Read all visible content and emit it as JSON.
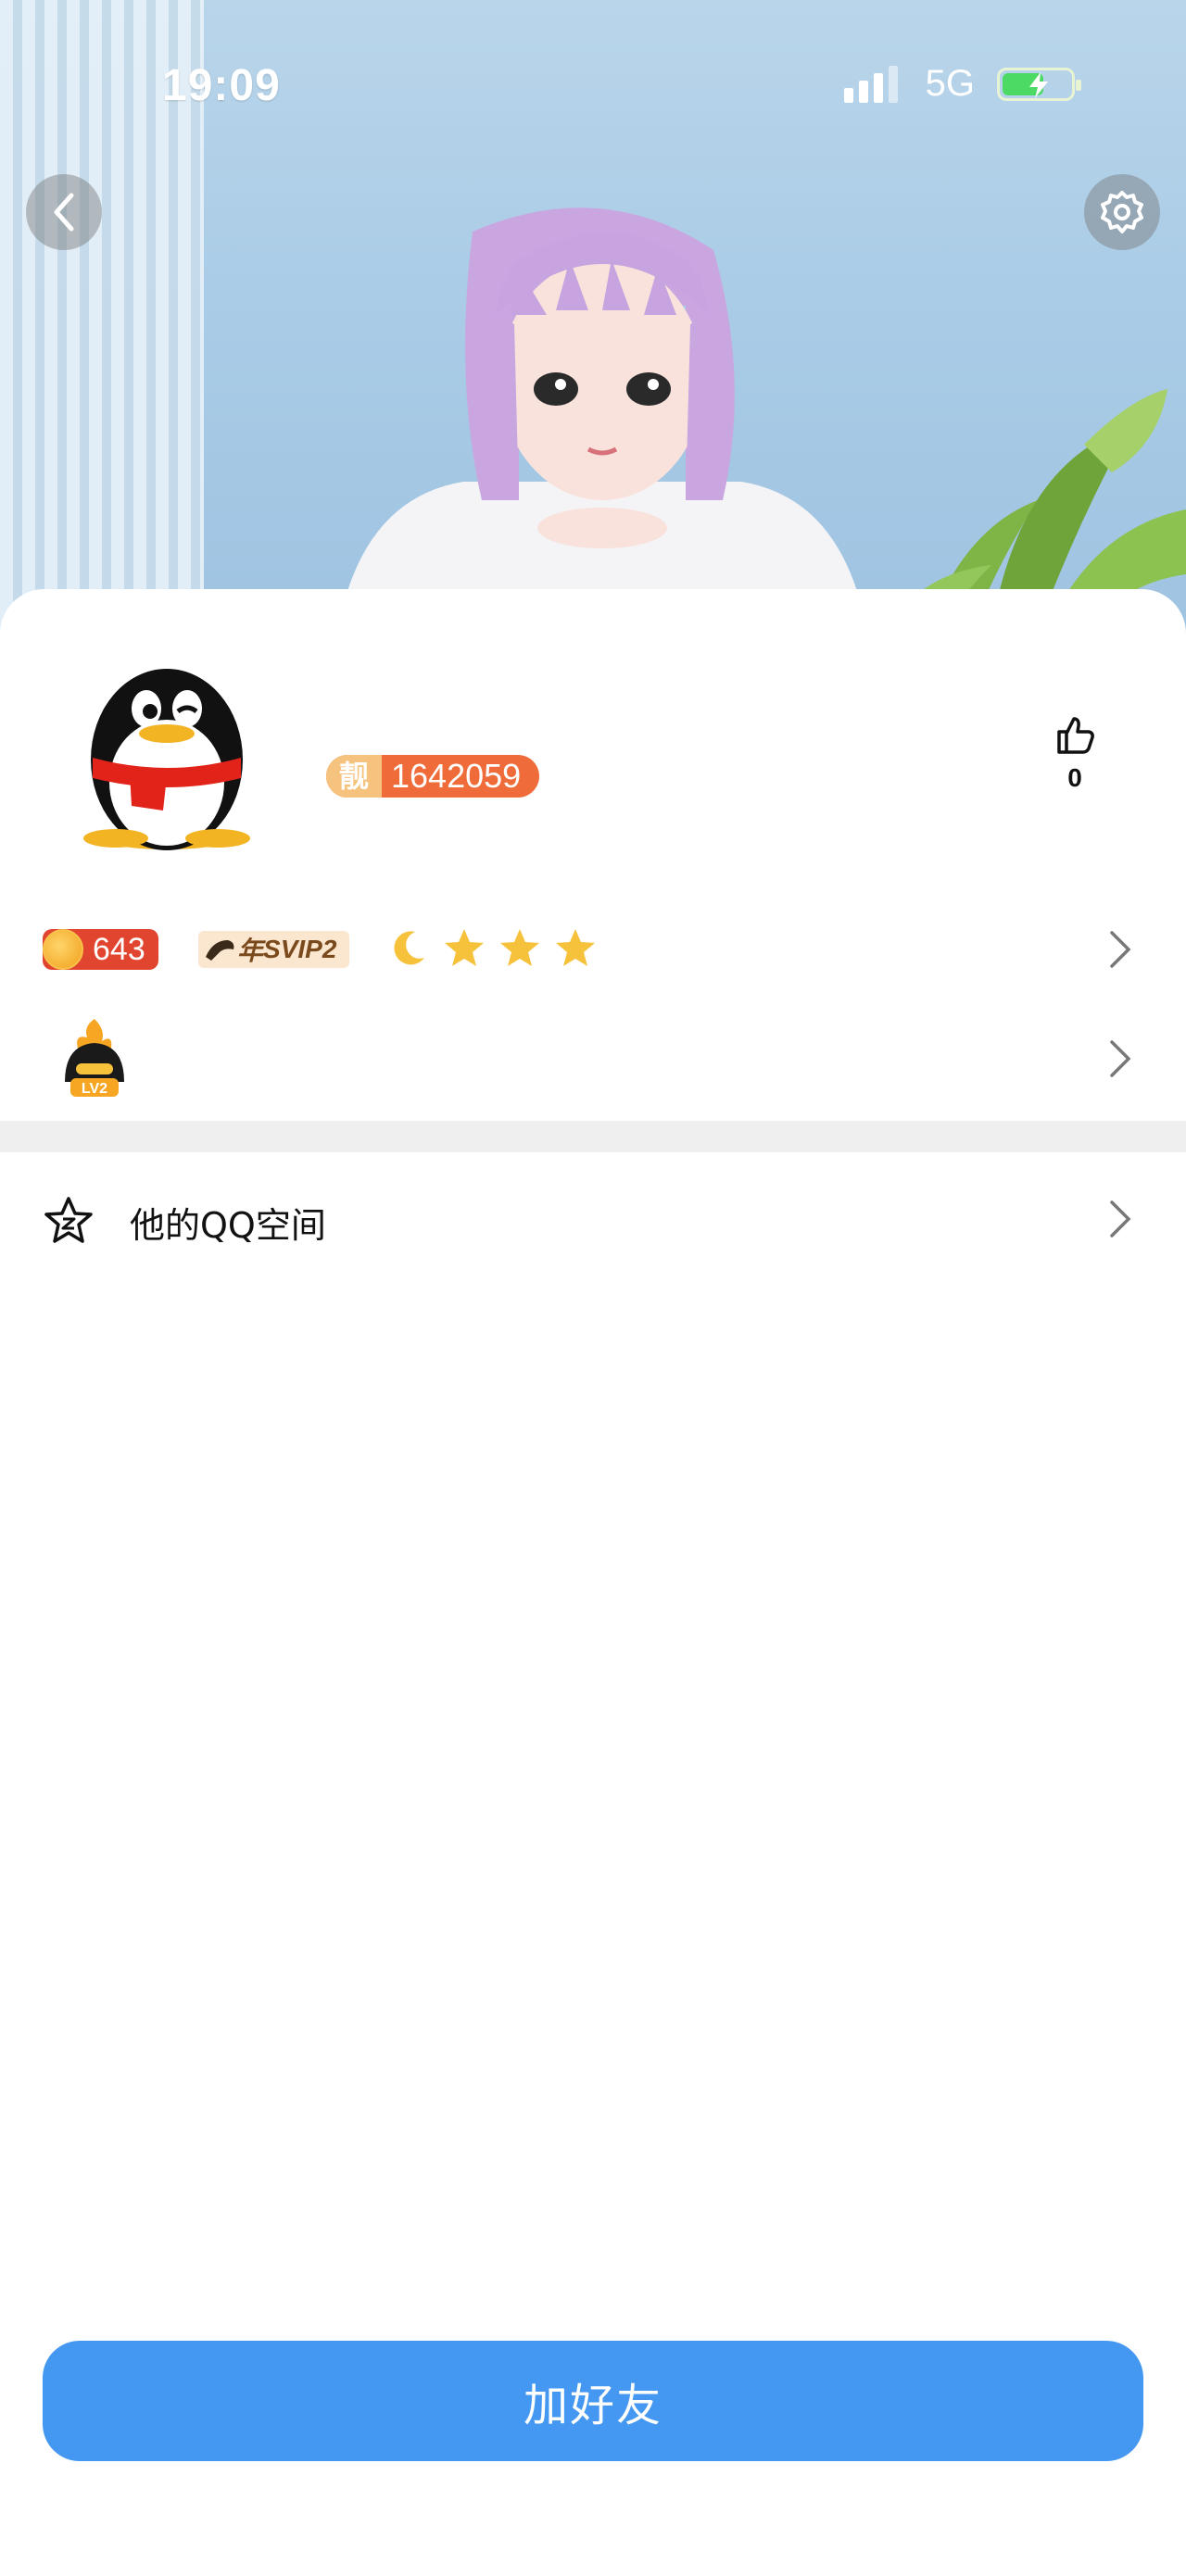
{
  "status_bar": {
    "time": "19:09",
    "network": "5G"
  },
  "profile": {
    "liang_tag": "靓",
    "qq_number": "1642059",
    "likes": "0"
  },
  "badges": {
    "coin_value": "643",
    "svip_prefix": "年",
    "svip_label": "SVIP2",
    "levels": [
      "moon-icon",
      "star-icon",
      "star-icon",
      "star-icon"
    ]
  },
  "game_level": {
    "label": "LV2"
  },
  "qzone": {
    "label": "他的QQ空间"
  },
  "actions": {
    "add_friend": "加好友"
  },
  "colors": {
    "primary": "#4598f1",
    "badge_orange": "#ef6b3a",
    "coin_red": "#e2452f"
  }
}
